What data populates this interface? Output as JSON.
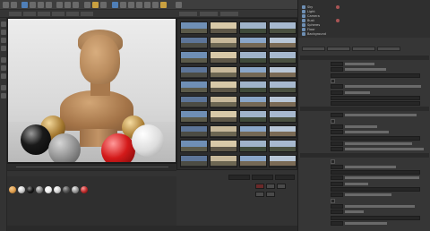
{
  "colors": {
    "accent": "#c9a040",
    "blue": "#4f7fb8",
    "panel_bg": "#3a3a3a"
  },
  "object_manager": {
    "rows": [
      {
        "name": "Sky",
        "icon": "sky-object-icon"
      },
      {
        "name": "Light",
        "icon": "light-object-icon"
      },
      {
        "name": "Camera",
        "icon": "camera-object-icon"
      },
      {
        "name": "Bust",
        "icon": "polygon-object-icon"
      },
      {
        "name": "Spheres",
        "icon": "null-object-icon"
      },
      {
        "name": "Floor",
        "icon": "floor-object-icon"
      },
      {
        "name": "Background",
        "icon": "background-object-icon"
      }
    ]
  },
  "attribute_manager": {
    "title": "",
    "sections": [
      "",
      "",
      ""
    ]
  },
  "materials": {
    "swatches": [
      {
        "color": "#e0a050",
        "icon": "material-swatch-icon"
      },
      {
        "color": "#cfcfcf",
        "icon": "material-swatch-icon"
      },
      {
        "color": "#1a1a1a",
        "icon": "material-swatch-icon"
      },
      {
        "color": "#888888",
        "icon": "material-swatch-icon"
      },
      {
        "color": "#ffffff",
        "icon": "material-swatch-icon"
      },
      {
        "color": "#d4d4d4",
        "icon": "material-swatch-icon"
      },
      {
        "color": "#555555",
        "icon": "material-swatch-icon"
      },
      {
        "color": "#9a9a9a",
        "icon": "material-swatch-icon"
      },
      {
        "color": "#c03030",
        "icon": "material-swatch-icon"
      }
    ]
  },
  "browser": {
    "thumbnails": 40
  }
}
